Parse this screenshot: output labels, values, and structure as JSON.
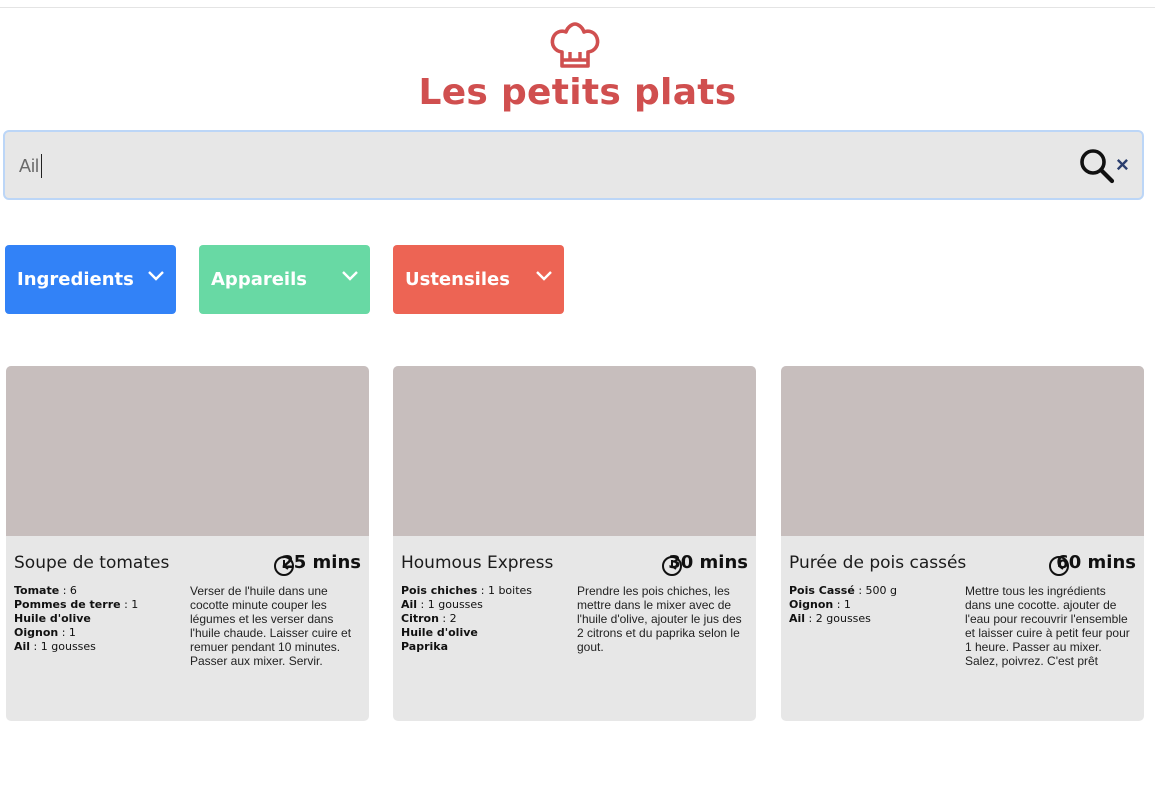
{
  "header": {
    "title": "Les petits plats",
    "logo_icon": "chef-hat-icon"
  },
  "search": {
    "value": "Ail",
    "search_icon": "search-icon",
    "clear_icon": "close-icon",
    "clear_label": "×"
  },
  "filters": [
    {
      "label": "Ingredients",
      "color": "#3282f7"
    },
    {
      "label": "Appareils",
      "color": "#68d9a4"
    },
    {
      "label": "Ustensiles",
      "color": "#ed6454"
    }
  ],
  "recipes": [
    {
      "name": "Soupe de tomates",
      "time": "25 mins",
      "ingredients": [
        {
          "name": "Tomate",
          "qty": " : 6"
        },
        {
          "name": "Pommes de terre",
          "qty": " : 1"
        },
        {
          "name": "Huile d'olive",
          "qty": ""
        },
        {
          "name": "Oignon",
          "qty": " : 1"
        },
        {
          "name": "Ail",
          "qty": " : 1 gousses"
        }
      ],
      "description": "Verser de l'huile dans une cocotte minute couper les légumes et les verser dans l'huile chaude. Laisser cuire et remuer pendant 10 minutes. Passer aux mixer. Servir."
    },
    {
      "name": "Houmous Express",
      "time": "30 mins",
      "ingredients": [
        {
          "name": "Pois chiches",
          "qty": " : 1 boites"
        },
        {
          "name": "Ail",
          "qty": " : 1 gousses"
        },
        {
          "name": "Citron",
          "qty": " : 2"
        },
        {
          "name": "Huile d'olive",
          "qty": ""
        },
        {
          "name": "Paprika",
          "qty": ""
        }
      ],
      "description": "Prendre les pois chiches, les mettre dans le mixer avec de l'huile d'olive, ajouter le jus des 2 citrons et du paprika selon le gout."
    },
    {
      "name": "Purée de pois cassés",
      "time": "60 mins",
      "ingredients": [
        {
          "name": "Pois Cassé",
          "qty": " : 500 g"
        },
        {
          "name": "Oignon",
          "qty": " : 1"
        },
        {
          "name": "Ail",
          "qty": " : 2 gousses"
        }
      ],
      "description": "Mettre tous les ingrédients dans une cocotte. ajouter de l'eau pour recouvrir l'ensemble et laisser cuire à petit feur pour 1 heure. Passer au mixer. Salez, poivrez. C'est prêt"
    }
  ]
}
